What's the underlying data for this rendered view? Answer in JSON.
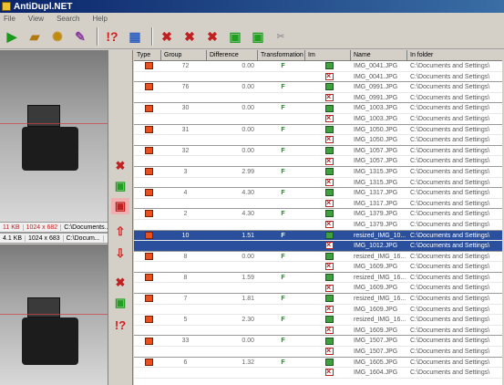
{
  "window": {
    "title": "AntiDupl.NET"
  },
  "menu": [
    "File",
    "View",
    "Search",
    "Help"
  ],
  "toolbar": [
    "start-icon",
    "open-folder-icon",
    "settings-icon",
    "erase-icon",
    "mistake-icon",
    "refresh-icon",
    "delete-first-icon",
    "delete-second-icon",
    "delete-both-icon",
    "rename-first-icon",
    "rename-second-icon",
    "undo-icon"
  ],
  "left": {
    "top_info": {
      "size": "11 KB",
      "dims": "1024 x 682",
      "path": "C:\\Documents..."
    },
    "bottom_info": {
      "size": "4.1 KB",
      "dims": "1024 x 683",
      "path": "C:\\Docum..."
    }
  },
  "mid_buttons": [
    "delete-both-icon",
    "delete-first-icon",
    "delete-second-icon",
    "up-arrow-icon",
    "down-arrow-icon",
    "delete-both-icon",
    "rename-icon",
    "mistake-icon"
  ],
  "table": {
    "columns": [
      "Type",
      "Group",
      "Difference",
      "Transformation",
      "Im",
      "Name",
      "In folder"
    ],
    "rows": [
      {
        "group": "72",
        "diff": "0.00",
        "trans": "F",
        "name": "IMG_0041.JPG",
        "folder": "C:\\Documents and Settings\\",
        "grp": false,
        "sel": false
      },
      {
        "group": "",
        "diff": "",
        "trans": "",
        "name": "IMG_0041.JPG",
        "folder": "C:\\Documents and Settings\\",
        "grp": true,
        "sel": false
      },
      {
        "group": "76",
        "diff": "0.00",
        "trans": "F",
        "name": "IMG_0991.JPG",
        "folder": "C:\\Documents and Settings\\",
        "grp": false,
        "sel": false
      },
      {
        "group": "",
        "diff": "",
        "trans": "",
        "name": "IMG_0991.JPG",
        "folder": "C:\\Documents and Settings\\",
        "grp": true,
        "sel": false
      },
      {
        "group": "30",
        "diff": "0.00",
        "trans": "F",
        "name": "IMG_1003.JPG",
        "folder": "C:\\Documents and Settings\\",
        "grp": false,
        "sel": false
      },
      {
        "group": "",
        "diff": "",
        "trans": "",
        "name": "IMG_1003.JPG",
        "folder": "C:\\Documents and Settings\\",
        "grp": true,
        "sel": false
      },
      {
        "group": "31",
        "diff": "0.00",
        "trans": "F",
        "name": "IMG_1050.JPG",
        "folder": "C:\\Documents and Settings\\",
        "grp": false,
        "sel": false
      },
      {
        "group": "",
        "diff": "",
        "trans": "",
        "name": "IMG_1050.JPG",
        "folder": "C:\\Documents and Settings\\",
        "grp": true,
        "sel": false
      },
      {
        "group": "32",
        "diff": "0.00",
        "trans": "F",
        "name": "IMG_1057.JPG",
        "folder": "C:\\Documents and Settings\\",
        "grp": false,
        "sel": false
      },
      {
        "group": "",
        "diff": "",
        "trans": "",
        "name": "IMG_1057.JPG",
        "folder": "C:\\Documents and Settings\\",
        "grp": true,
        "sel": false
      },
      {
        "group": "3",
        "diff": "2.99",
        "trans": "F",
        "name": "IMG_1315.JPG",
        "folder": "C:\\Documents and Settings\\",
        "grp": false,
        "sel": false
      },
      {
        "group": "",
        "diff": "",
        "trans": "",
        "name": "IMG_1315.JPG",
        "folder": "C:\\Documents and Settings\\",
        "grp": true,
        "sel": false
      },
      {
        "group": "4",
        "diff": "4.30",
        "trans": "F",
        "name": "IMG_1317.JPG",
        "folder": "C:\\Documents and Settings\\",
        "grp": false,
        "sel": false
      },
      {
        "group": "",
        "diff": "",
        "trans": "",
        "name": "IMG_1317.JPG",
        "folder": "C:\\Documents and Settings\\",
        "grp": true,
        "sel": false
      },
      {
        "group": "2",
        "diff": "4.30",
        "trans": "F",
        "name": "IMG_1379.JPG",
        "folder": "C:\\Documents and Settings\\",
        "grp": false,
        "sel": false
      },
      {
        "group": "",
        "diff": "",
        "trans": "",
        "name": "IMG_1379.JPG",
        "folder": "C:\\Documents and Settings\\",
        "grp": true,
        "sel": false
      },
      {
        "group": "10",
        "diff": "1.51",
        "trans": "F",
        "name": "resized_IMG_10...",
        "folder": "C:\\Documents and Settings\\",
        "grp": false,
        "sel": true
      },
      {
        "group": "",
        "diff": "",
        "trans": "",
        "name": "IMG_1012.JPG",
        "folder": "C:\\Documents and Settings\\",
        "grp": true,
        "sel": true
      },
      {
        "group": "8",
        "diff": "0.00",
        "trans": "F",
        "name": "resized_IMG_16...",
        "folder": "C:\\Documents and Settings\\",
        "grp": false,
        "sel": false
      },
      {
        "group": "",
        "diff": "",
        "trans": "",
        "name": "IMG_1609.JPG",
        "folder": "C:\\Documents and Settings\\",
        "grp": true,
        "sel": false
      },
      {
        "group": "8",
        "diff": "1.59",
        "trans": "F",
        "name": "resized_IMG_16...",
        "folder": "C:\\Documents and Settings\\",
        "grp": false,
        "sel": false
      },
      {
        "group": "",
        "diff": "",
        "trans": "",
        "name": "IMG_1609.JPG",
        "folder": "C:\\Documents and Settings\\",
        "grp": true,
        "sel": false
      },
      {
        "group": "7",
        "diff": "1.81",
        "trans": "F",
        "name": "resized_IMG_16...",
        "folder": "C:\\Documents and Settings\\",
        "grp": false,
        "sel": false
      },
      {
        "group": "",
        "diff": "",
        "trans": "",
        "name": "IMG_1609.JPG",
        "folder": "C:\\Documents and Settings\\",
        "grp": false,
        "sel": false
      },
      {
        "group": "5",
        "diff": "2.30",
        "trans": "F",
        "name": "resized_IMG_16...",
        "folder": "C:\\Documents and Settings\\",
        "grp": false,
        "sel": false
      },
      {
        "group": "",
        "diff": "",
        "trans": "",
        "name": "IMG_1609.JPG",
        "folder": "C:\\Documents and Settings\\",
        "grp": true,
        "sel": false
      },
      {
        "group": "33",
        "diff": "0.00",
        "trans": "F",
        "name": "IMG_1507.JPG",
        "folder": "C:\\Documents and Settings\\",
        "grp": false,
        "sel": false
      },
      {
        "group": "",
        "diff": "",
        "trans": "",
        "name": "IMG_1507.JPG",
        "folder": "C:\\Documents and Settings\\",
        "grp": true,
        "sel": false
      },
      {
        "group": "6",
        "diff": "1.32",
        "trans": "F",
        "name": "IMG_1605.JPG",
        "folder": "C:\\Documents and Settings\\",
        "grp": false,
        "sel": false
      },
      {
        "group": "",
        "diff": "",
        "trans": "",
        "name": "IMG_1604.JPG",
        "folder": "C:\\Documents and Settings\\",
        "grp": false,
        "sel": false
      }
    ]
  }
}
